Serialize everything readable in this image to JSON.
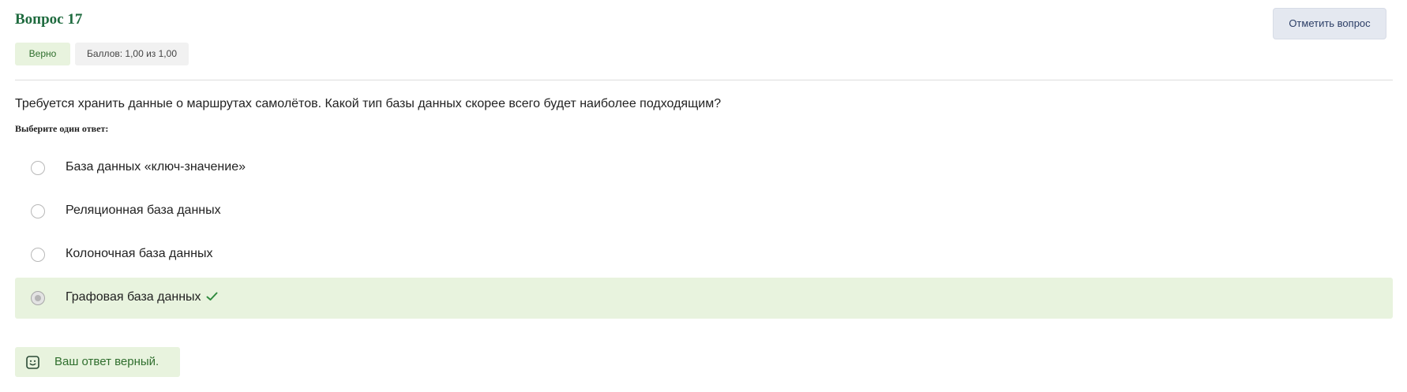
{
  "question": {
    "title": "Вопрос 17",
    "status_badge": "Верно",
    "score_badge": "Баллов: 1,00 из 1,00",
    "flag_button": "Отметить вопрос",
    "text": "Требуется хранить данные о маршрутах самолётов. Какой тип базы данных скорее всего будет наиболее подходящим?",
    "prompt": "Выберите один ответ:",
    "options": [
      {
        "label": "База данных «ключ-значение»",
        "selected": false,
        "correct": false
      },
      {
        "label": "Реляционная база данных",
        "selected": false,
        "correct": false
      },
      {
        "label": "Колоночная база данных",
        "selected": false,
        "correct": false
      },
      {
        "label": "Графовая база данных",
        "selected": true,
        "correct": true
      }
    ],
    "feedback": "Ваш ответ верный."
  },
  "icons": {
    "check": "check-icon",
    "feedback": "smile-icon"
  },
  "colors": {
    "title": "#1f6b3f",
    "correct_bg": "#e8f3de",
    "correct_text": "#2f6e2d",
    "flag_bg": "#e4e8f0",
    "check": "#2f8a3e"
  }
}
